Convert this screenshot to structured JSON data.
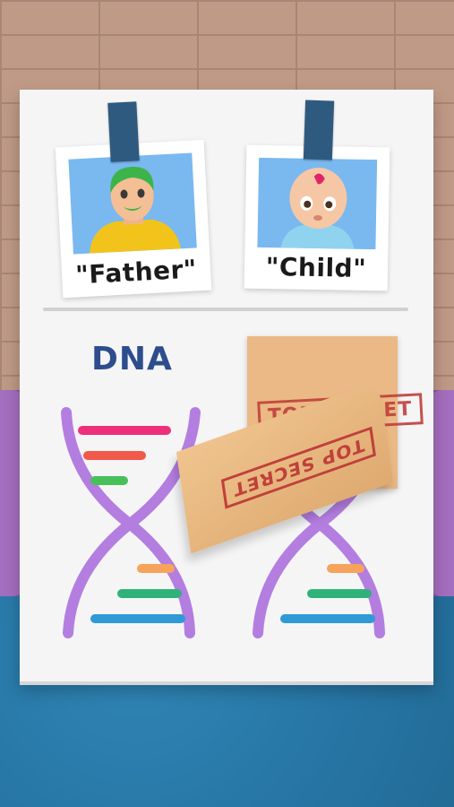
{
  "photos": {
    "father": {
      "caption": "\"Father\""
    },
    "child": {
      "caption": "\"Child\""
    }
  },
  "dna": {
    "label": "DNA"
  },
  "envelope": {
    "stamp_top": "TOP SECRET",
    "stamp_flap": "TOP SECRET"
  },
  "colors": {
    "helix": "#b37ee0",
    "bar_pink": "#ee2f7a",
    "bar_red": "#f15a4a",
    "bar_green": "#48c05a",
    "bar_orange": "#f6a35c",
    "bar_teal": "#2fb27a",
    "bar_blue": "#2f9ad6"
  }
}
